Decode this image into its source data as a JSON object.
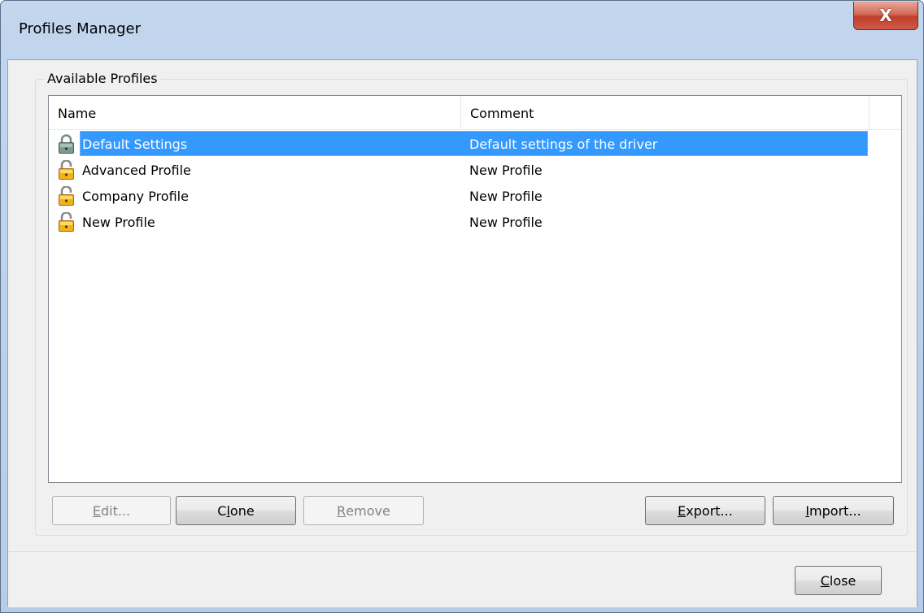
{
  "window": {
    "title": "Profiles Manager",
    "close_glyph": "X"
  },
  "group": {
    "label": "Available Profiles"
  },
  "list": {
    "columns": [
      "Name",
      "Comment"
    ],
    "rows": [
      {
        "name": "Default Settings",
        "comment": "Default settings of the driver",
        "icon": "locked-padlock-icon",
        "selected": true
      },
      {
        "name": "Advanced Profile",
        "comment": "New Profile",
        "icon": "unlocked-padlock-icon",
        "selected": false
      },
      {
        "name": "Company Profile",
        "comment": "New Profile",
        "icon": "unlocked-padlock-icon",
        "selected": false
      },
      {
        "name": "New Profile",
        "comment": "New Profile",
        "icon": "unlocked-padlock-icon",
        "selected": false
      }
    ]
  },
  "buttons": {
    "edit": {
      "pre": "",
      "acc": "E",
      "post": "dit...",
      "disabled": true
    },
    "clone": {
      "pre": "C",
      "acc": "l",
      "post": "one",
      "disabled": false
    },
    "remove": {
      "pre": "",
      "acc": "R",
      "post": "emove",
      "disabled": true
    },
    "export": {
      "pre": "",
      "acc": "E",
      "post": "xport...",
      "disabled": false
    },
    "import": {
      "pre": "",
      "acc": "I",
      "post": "mport...",
      "disabled": false
    },
    "close": {
      "pre": "",
      "acc": "C",
      "post": "lose",
      "disabled": false
    }
  },
  "colors": {
    "selection": "#3399ff",
    "title_bar": "#bcd3ed",
    "close_button": "#c13e2c"
  }
}
